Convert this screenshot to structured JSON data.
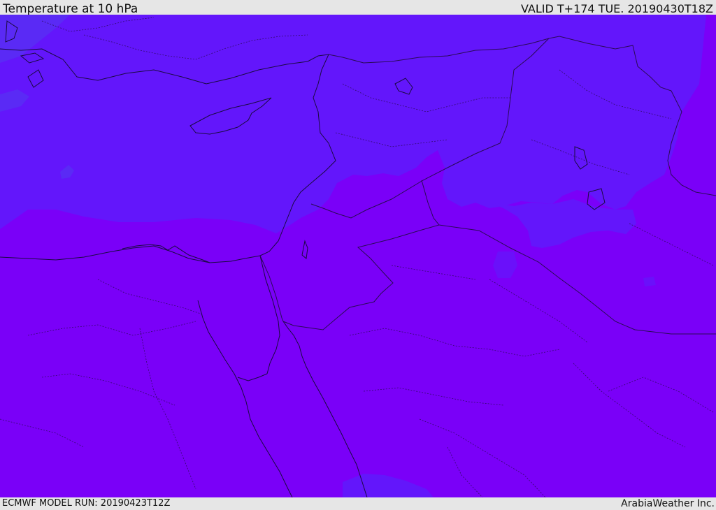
{
  "header": {
    "title": "Temperature at 10 hPa",
    "valid_time": "VALID T+174 TUE. 20190430T18Z"
  },
  "footer": {
    "model_run": "ECMWF MODEL RUN: 20190423T12Z",
    "brand": "ArabiaWeather Inc."
  },
  "map": {
    "field": "temperature",
    "level": "10 hPa",
    "colors": {
      "cooler_band": "#6316fb",
      "cool_edge": "#5a2af5",
      "warmer_band": "#7a00f8",
      "coastline": "#1a0a40",
      "border": "#2a0a55"
    }
  }
}
